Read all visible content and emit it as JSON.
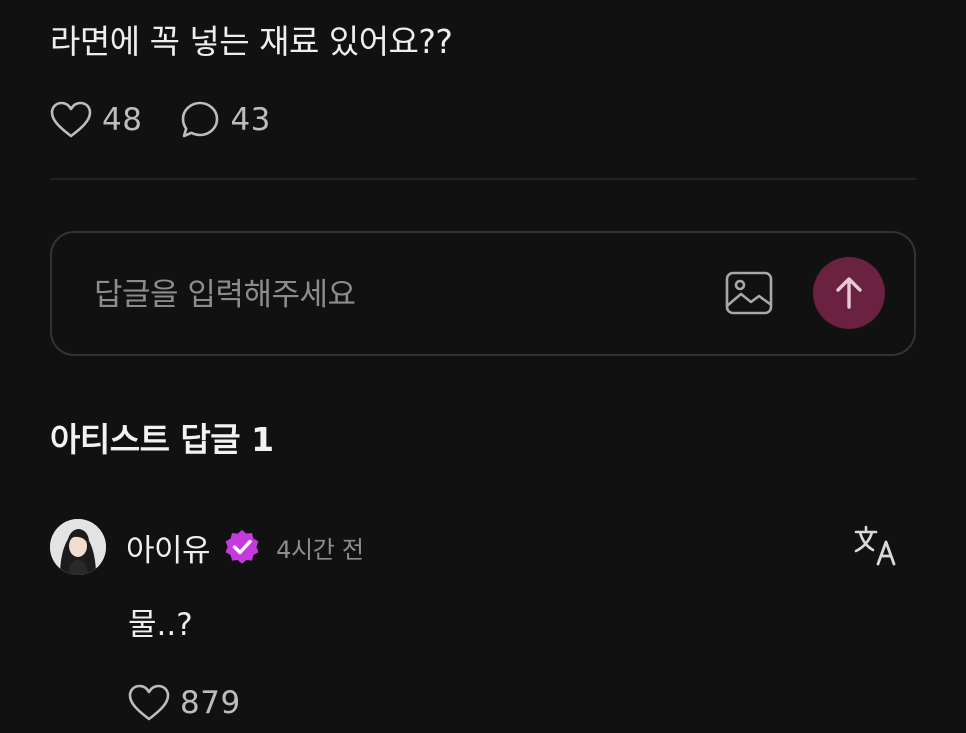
{
  "post": {
    "text": "라면에 꼭 넣는 재료 있어요??",
    "like_icon": "heart-outline-icon",
    "like_count": "48",
    "comment_icon": "speech-bubble-icon",
    "comment_count": "43"
  },
  "reply_box": {
    "placeholder": "답글을 입력해주세요",
    "image_icon": "image-icon",
    "send_icon": "arrow-up-icon",
    "send_button_color": "#6a2240"
  },
  "artist_replies": {
    "title": "아티스트 답글 1",
    "items": [
      {
        "author": "아이유",
        "verified_icon": "verified-badge-icon",
        "verified_color": "#c43ae0",
        "time": "4시간 전",
        "translate_icon": "translate-icon",
        "text": "물..?",
        "like_icon": "heart-outline-icon",
        "like_count": "879"
      }
    ]
  },
  "colors": {
    "background": "#111111",
    "text_primary": "#eeeeee",
    "text_secondary": "#8d8d8d",
    "divider": "#222222",
    "border": "#333333"
  }
}
